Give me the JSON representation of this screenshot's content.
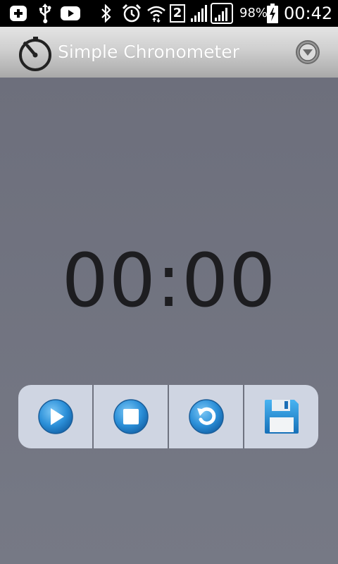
{
  "status_bar": {
    "icons": [
      "add-box-icon",
      "usb-icon",
      "youtube-icon",
      "bluetooth-icon",
      "alarm-icon",
      "wifi-icon",
      "sim-2-icon",
      "signal-icon",
      "signal-icon",
      "battery-charging-icon"
    ],
    "sim_label": "2",
    "battery_percent": "98%",
    "time": "00:42"
  },
  "action_bar": {
    "title": "Simple Chronometer",
    "app_icon": "stopwatch-icon",
    "overflow_icon": "chevron-down-circle-icon"
  },
  "timer": {
    "display": "00:00"
  },
  "controls": [
    {
      "name": "play",
      "icon": "play-icon"
    },
    {
      "name": "stop",
      "icon": "stop-icon"
    },
    {
      "name": "reset",
      "icon": "reset-icon"
    },
    {
      "name": "save",
      "icon": "floppy-disk-icon"
    }
  ],
  "colors": {
    "background": "#717481",
    "controls_bg": "#cfd5e2",
    "button_blue": "#1e8ad6",
    "timer_text": "#1d1d20"
  }
}
